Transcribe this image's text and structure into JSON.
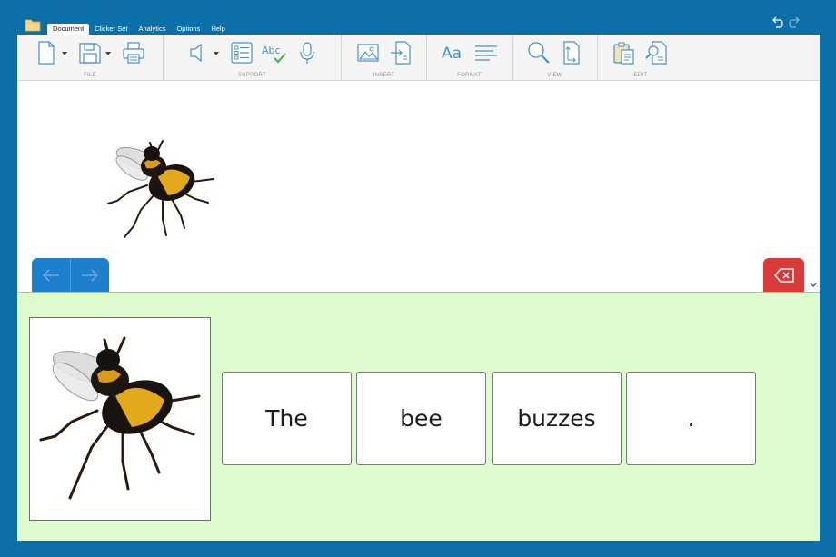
{
  "icons": {
    "folder": "folder-icon",
    "undo": "undo-icon",
    "redo": "redo-icon"
  },
  "menu": {
    "tabs": [
      {
        "label": "Document",
        "active": true
      },
      {
        "label": "Clicker Set",
        "active": false
      },
      {
        "label": "Analytics",
        "active": false
      },
      {
        "label": "Options",
        "active": false
      },
      {
        "label": "Help",
        "active": false
      }
    ]
  },
  "ribbon": {
    "groups": [
      {
        "label": "FILE",
        "buttons": [
          "new-document-icon",
          "save-icon",
          "print-icon"
        ]
      },
      {
        "label": "SUPPORT",
        "buttons": [
          "speech-icon",
          "word-list-icon",
          "spell-check-icon",
          "microphone-icon"
        ]
      },
      {
        "label": "INSERT",
        "buttons": [
          "image-icon",
          "insert-file-icon"
        ]
      },
      {
        "label": "FORMAT",
        "buttons": [
          "font-icon",
          "paragraph-icon"
        ]
      },
      {
        "label": "VIEW",
        "buttons": [
          "zoom-icon",
          "page-size-icon"
        ]
      },
      {
        "label": "EDIT",
        "buttons": [
          "paste-icon",
          "find-replace-icon"
        ]
      }
    ]
  },
  "grid": {
    "words": [
      "The",
      "bee",
      "buzzes",
      "."
    ]
  },
  "colors": {
    "frame": "#0d6fa8",
    "nav_blue": "#1e7fcf",
    "delete_red": "#d93a3a",
    "grid_green": "#ddfbcc"
  }
}
